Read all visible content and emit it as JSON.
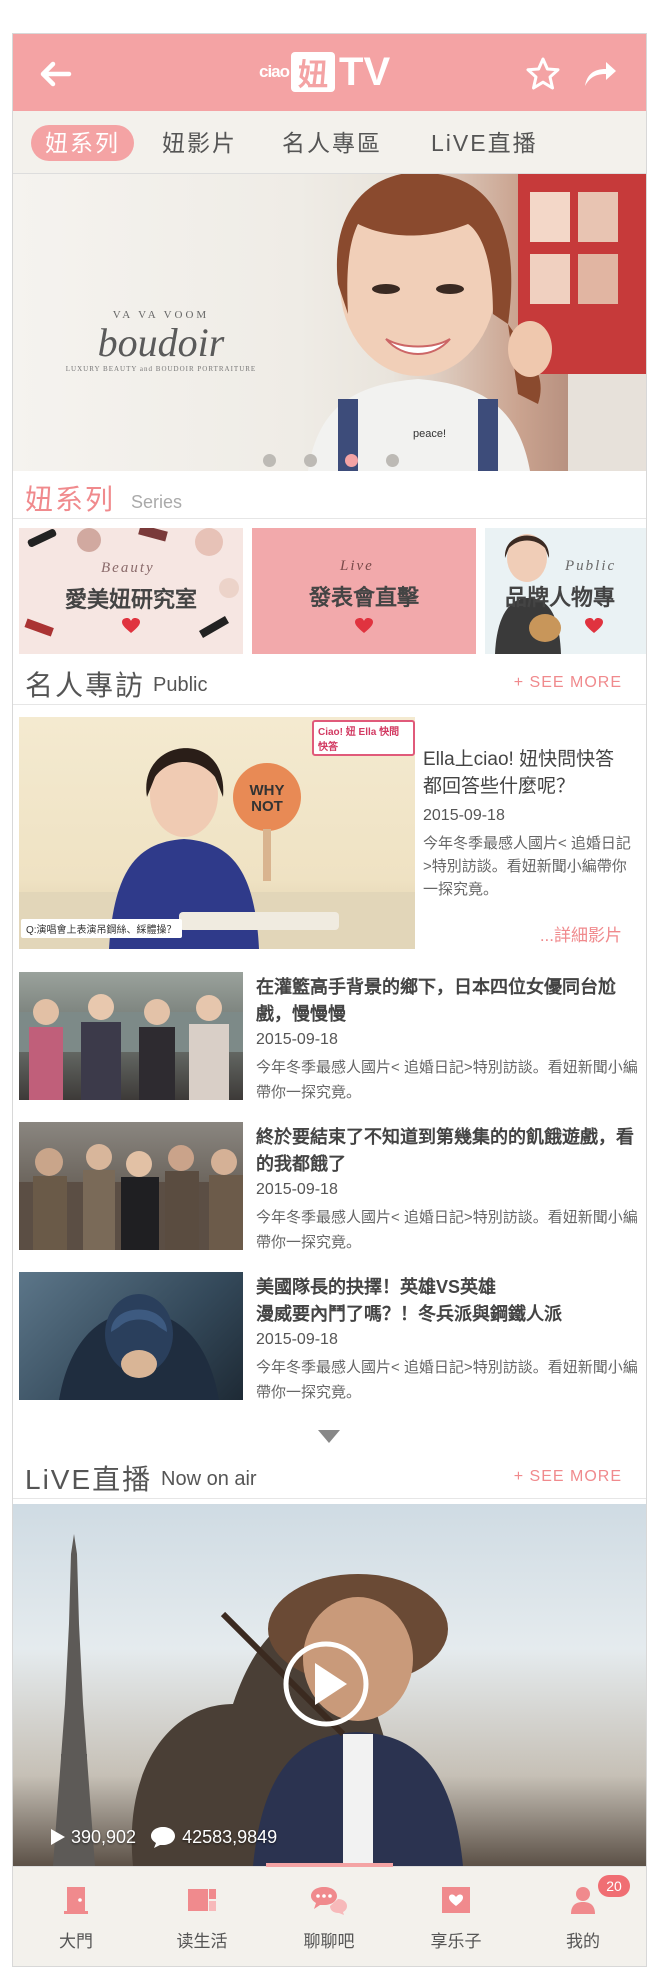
{
  "header": {
    "logo_ciao": "ciao",
    "logo_char": "妞",
    "logo_tv": "TV"
  },
  "tabs": [
    {
      "label": "妞系列",
      "active": true
    },
    {
      "label": "妞影片",
      "active": false
    },
    {
      "label": "名人專區",
      "active": false
    },
    {
      "label": "LiVE直播",
      "active": false
    }
  ],
  "hero": {
    "brand_small": "VA VA VOOM",
    "brand_script": "boudoir",
    "brand_tag": "LUXURY BEAUTY and BOUDOIR PORTRAITURE",
    "shirt_text": "peace!",
    "slide_count": 4,
    "active_slide": 3
  },
  "series_section": {
    "title": "妞系列",
    "subtitle": "Series"
  },
  "series": [
    {
      "en": "Beauty",
      "label": "愛美妞研究室"
    },
    {
      "en": "Live",
      "label": "發表會直擊"
    },
    {
      "en": "Public",
      "label": "品牌人物專"
    }
  ],
  "public_section": {
    "title": "名人專訪",
    "subtitle": "Public",
    "see_more": "+ SEE MORE"
  },
  "feature": {
    "badge": "Ciao! 妞 Ella 快問快答",
    "sign": "WHY NOT",
    "caption": "Q:演唱會上表演吊鋼絲、綵體操？",
    "title": "Ella上ciao! 妞快問快答都回答些什麼呢？",
    "date": "2015-09-18",
    "desc": "今年冬季最感人國片< 追婚日記>特別訪談。看妞新聞小編帶你一探究竟。",
    "more": "...詳細影片"
  },
  "articles": [
    {
      "title": "在灌籃高手背景的鄉下，日本四位女優同台尬戲，慢慢慢",
      "date": "2015-09-18",
      "desc": "今年冬季最感人國片< 追婚日記>特別訪談。看妞新聞小編帶你一探究竟。"
    },
    {
      "title": "終於要結束了不知道到第幾集的的飢餓遊戲，看的我都餓了",
      "date": "2015-09-18",
      "desc": "今年冬季最感人國片< 追婚日記>特別訪談。看妞新聞小編帶你一探究竟。"
    },
    {
      "title": "美國隊長的抉擇！英雄VS英雄\n漫威要內鬥了嗎？！冬兵派與鋼鐵人派",
      "date": "2015-09-18",
      "desc": "今年冬季最感人國片< 追婚日記>特別訪談。看妞新聞小編帶你一探究竟。"
    }
  ],
  "live_section": {
    "title": "LiVE直播",
    "subtitle": "Now on air",
    "see_more": "+ SEE MORE"
  },
  "live": {
    "views": "390,902",
    "comments": "42583,9849"
  },
  "bottom_nav": [
    {
      "label": "大門",
      "icon": "door-icon"
    },
    {
      "label": "读生活",
      "icon": "news-icon"
    },
    {
      "label": "聊聊吧",
      "icon": "chat-icon",
      "active": true
    },
    {
      "label": "享乐子",
      "icon": "heart-box-icon"
    },
    {
      "label": "我的",
      "icon": "user-icon",
      "badge": "20"
    }
  ],
  "colors": {
    "accent": "#f4a3a4",
    "link": "#f08a8d",
    "tab_bg": "#f3f1ec"
  }
}
